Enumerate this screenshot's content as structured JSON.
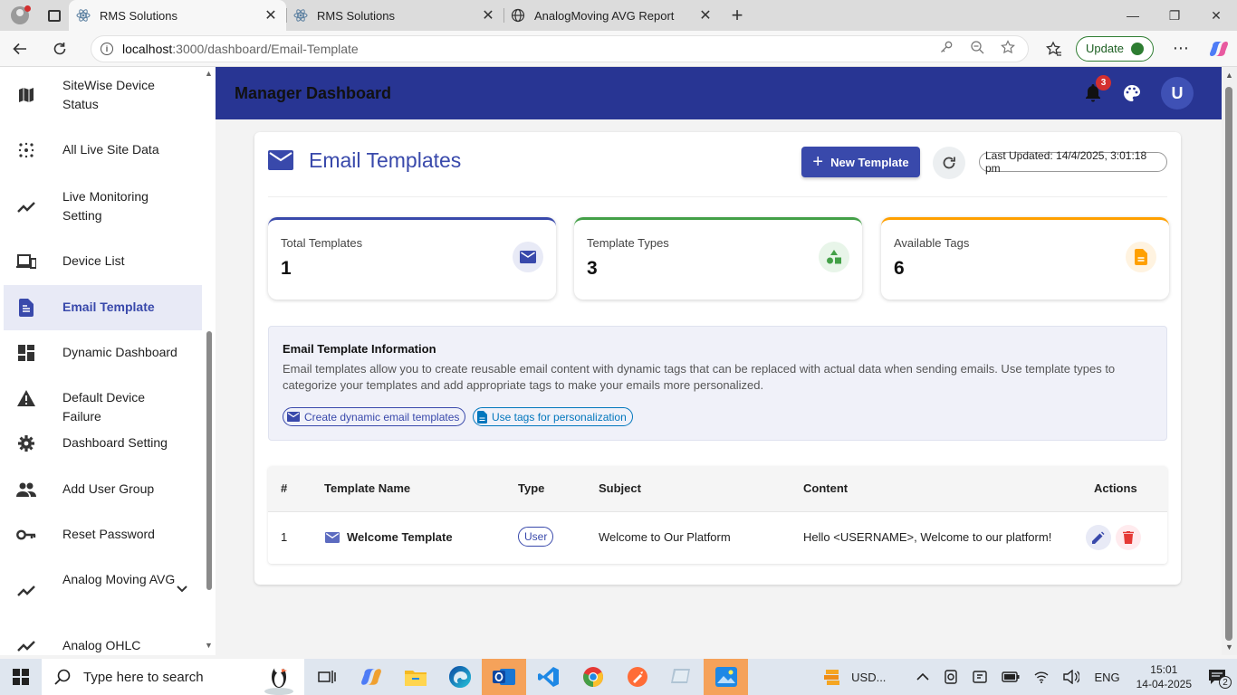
{
  "browser": {
    "tabs": [
      {
        "title": "RMS Solutions",
        "active": true
      },
      {
        "title": "RMS Solutions",
        "active": false
      },
      {
        "title": "AnalogMoving AVG Report",
        "active": false
      }
    ],
    "url_host": "localhost",
    "url_path": ":3000/dashboard/Email-Template",
    "update_label": "Update"
  },
  "sidebar": {
    "items": [
      {
        "label": "SiteWise Device Status",
        "icon": "map-icon"
      },
      {
        "label": "All Live Site Data",
        "icon": "scatter-icon"
      },
      {
        "label": "Live Monitoring Setting",
        "icon": "trend-icon"
      },
      {
        "label": "Device List",
        "icon": "devices-icon"
      },
      {
        "label": "Email Template",
        "icon": "document-icon",
        "active": true
      },
      {
        "label": "Dynamic Dashboard",
        "icon": "dashboard-icon"
      },
      {
        "label": "Default Device Failure",
        "icon": "warning-icon"
      },
      {
        "label": "Dashboard Setting",
        "icon": "gear-icon"
      },
      {
        "label": "Add User Group",
        "icon": "group-icon"
      },
      {
        "label": "Reset Password",
        "icon": "key-icon"
      },
      {
        "label": "Analog Moving AVG",
        "icon": "trend-icon",
        "expandable": true
      },
      {
        "label": "Analog OHLC",
        "icon": "trend-icon"
      }
    ]
  },
  "header": {
    "title": "Manager Dashboard",
    "notification_count": "3",
    "user_initial": "U",
    "bg_color": "#283593"
  },
  "page": {
    "title": "Email Templates",
    "new_button": "New Template",
    "last_updated": "Last Updated: 14/4/2025, 3:01:18 pm"
  },
  "stats": [
    {
      "label": "Total Templates",
      "value": "1",
      "color": "#3949ab",
      "icon": "mail-icon"
    },
    {
      "label": "Template Types",
      "value": "3",
      "color": "#43a047",
      "icon": "category-icon"
    },
    {
      "label": "Available Tags",
      "value": "6",
      "color": "#ffa000",
      "icon": "document-icon"
    }
  ],
  "info": {
    "heading": "Email Template Information",
    "body": "Email templates allow you to create reusable email content with dynamic tags that can be replaced with actual data when sending emails. Use template types to categorize your templates and add appropriate tags to make your emails more personalized.",
    "chips": [
      "Create dynamic email templates",
      "Use tags for personalization"
    ]
  },
  "table": {
    "columns": [
      "#",
      "Template Name",
      "Type",
      "Subject",
      "Content",
      "Actions"
    ],
    "rows": [
      {
        "num": "1",
        "name": "Welcome Template",
        "type": "User",
        "subject": "Welcome to Our Platform",
        "content": "Hello <USERNAME>, Welcome to our platform!"
      }
    ]
  },
  "taskbar": {
    "search_placeholder": "Type here to search",
    "currency": "USD...",
    "lang": "ENG",
    "time": "15:01",
    "date": "14-04-2025",
    "notif_count": "2"
  }
}
